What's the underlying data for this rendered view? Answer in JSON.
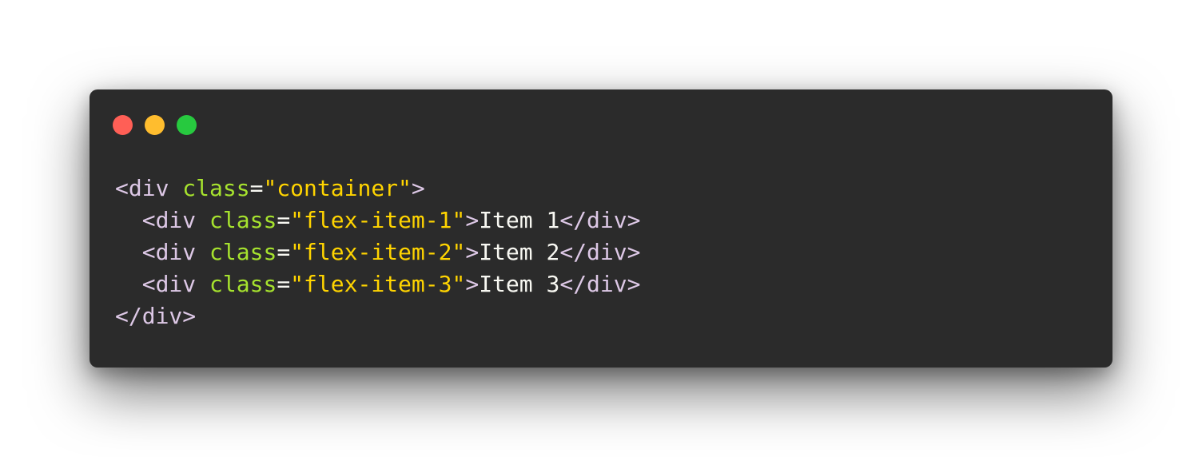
{
  "window": {
    "controls": {
      "close": {
        "icon": "close-dot-icon",
        "color": "#ff5f56"
      },
      "minimize": {
        "icon": "minimize-dot-icon",
        "color": "#ffbd2e"
      },
      "maximize": {
        "icon": "maximize-dot-icon",
        "color": "#27c93f"
      }
    },
    "background": "#2b2b2b"
  },
  "colors": {
    "tag": "#ddc8e6",
    "attribute": "#a6e22e",
    "string": "#ffd400",
    "text": "#f8f8f2"
  },
  "code": {
    "lines": [
      {
        "indent": "",
        "open": "<div",
        "attr": "class",
        "eq": "=",
        "value": "\"container\"",
        "close": ">",
        "text": "",
        "end": ""
      },
      {
        "indent": "  ",
        "open": "<div",
        "attr": "class",
        "eq": "=",
        "value": "\"flex-item-1\"",
        "close": ">",
        "text": "Item 1",
        "end": "</div>"
      },
      {
        "indent": "  ",
        "open": "<div",
        "attr": "class",
        "eq": "=",
        "value": "\"flex-item-2\"",
        "close": ">",
        "text": "Item 2",
        "end": "</div>"
      },
      {
        "indent": "  ",
        "open": "<div",
        "attr": "class",
        "eq": "=",
        "value": "\"flex-item-3\"",
        "close": ">",
        "text": "Item 3",
        "end": "</div>"
      },
      {
        "indent": "",
        "open": "",
        "attr": "",
        "eq": "",
        "value": "",
        "close": "",
        "text": "",
        "end": "</div>"
      }
    ]
  }
}
